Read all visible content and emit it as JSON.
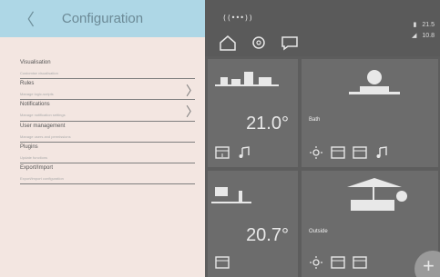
{
  "header": {
    "title": "Configuration",
    "back_glyph": "〈"
  },
  "menu": {
    "items": [
      {
        "label": "Visualisation",
        "sub": "Customise visualisation",
        "has_chevron": false
      },
      {
        "label": "Rules",
        "sub": "Manage logic-scripts",
        "has_chevron": true
      },
      {
        "label": "Notifications",
        "sub": "Manage notification settings",
        "has_chevron": true
      },
      {
        "label": "User management",
        "sub": "Manage users and permissions",
        "has_chevron": false
      },
      {
        "label": "Plugins",
        "sub": "Update functions",
        "has_chevron": false
      },
      {
        "label": "Export/Import",
        "sub": "Export/import configuration",
        "has_chevron": false
      }
    ]
  },
  "dashboard": {
    "brand": "((•••))",
    "system": {
      "line1": "21.5",
      "line2": "10.8"
    },
    "tiles": [
      {
        "room": "",
        "temp": "21.0°"
      },
      {
        "room": "Bath",
        "temp": ""
      },
      {
        "room": "",
        "temp": "20.7°"
      },
      {
        "room": "Outside",
        "temp": ""
      }
    ],
    "fab_glyph": "+"
  },
  "colors": {
    "drawer_bg": "#f3e6e1",
    "header_bg": "#aed7e6",
    "header_text": "#6c8a96",
    "dash_bg": "#5d5d5d",
    "tile_bg": "#6c6c6c"
  },
  "icons": [
    "home-icon",
    "settings-icon",
    "chat-icon",
    "thermometer-icon",
    "wifi-icon",
    "light-icon",
    "blind-icon",
    "music-icon",
    "add-icon"
  ]
}
